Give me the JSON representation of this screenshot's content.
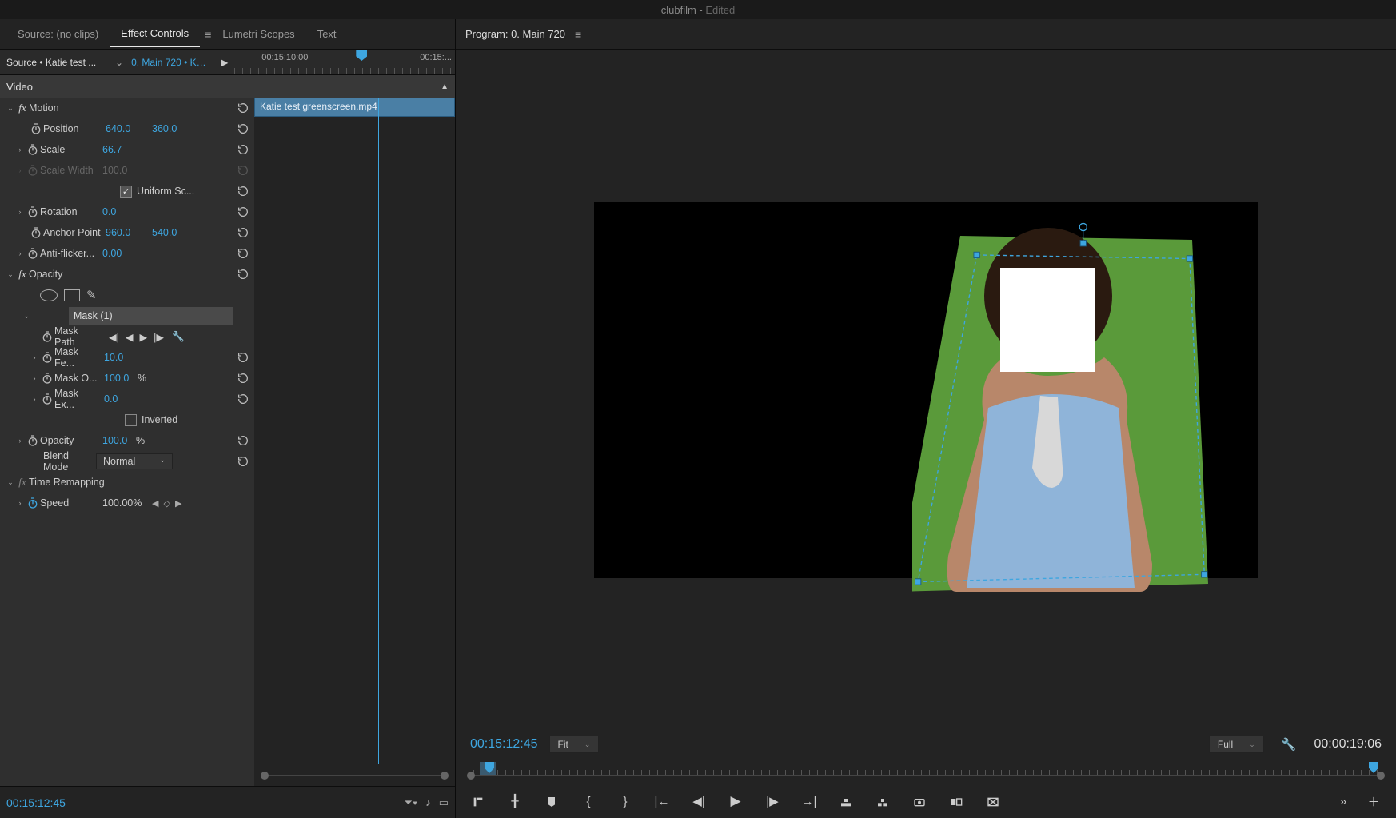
{
  "titlebar": {
    "project": "clubfilm",
    "status": "Edited"
  },
  "left": {
    "tabs": {
      "source": "Source: (no clips)",
      "effect_controls": "Effect Controls",
      "lumetri": "Lumetri Scopes",
      "text": "Text"
    },
    "src_header": {
      "source_clip": "Source • Katie test ...",
      "sequence": "0. Main 720 • Ka...",
      "ruler_tc1": "00:15:10:00",
      "ruler_tc2": "00:15:..."
    },
    "section_header": "Video",
    "clip_name": "Katie test greenscreen.mp4",
    "motion": {
      "label": "Motion",
      "position": {
        "label": "Position",
        "x": "640.0",
        "y": "360.0"
      },
      "scale": {
        "label": "Scale",
        "v": "66.7"
      },
      "scale_width": {
        "label": "Scale Width",
        "v": "100.0"
      },
      "uniform": {
        "label": "Uniform Sc...",
        "checked": true
      },
      "rotation": {
        "label": "Rotation",
        "v": "0.0"
      },
      "anchor": {
        "label": "Anchor Point",
        "x": "960.0",
        "y": "540.0"
      },
      "antiflicker": {
        "label": "Anti-flicker...",
        "v": "0.00"
      }
    },
    "opacity": {
      "label": "Opacity",
      "mask_name": "Mask (1)",
      "mask_path": "Mask Path",
      "mask_feather": {
        "label": "Mask Fe...",
        "v": "10.0"
      },
      "mask_opacity": {
        "label": "Mask O...",
        "v": "100.0",
        "unit": "%"
      },
      "mask_expansion": {
        "label": "Mask Ex...",
        "v": "0.0"
      },
      "inverted": {
        "label": "Inverted",
        "checked": false
      },
      "opacity_val": {
        "label": "Opacity",
        "v": "100.0",
        "unit": "%"
      },
      "blend": {
        "label": "Blend Mode",
        "v": "Normal"
      }
    },
    "time_remap": {
      "label": "Time Remapping",
      "speed": {
        "label": "Speed",
        "v": "100.00%"
      }
    },
    "footer_tc": "00:15:12:45"
  },
  "right": {
    "header": "Program: 0. Main 720",
    "footer": {
      "tc_left": "00:15:12:45",
      "zoom": "Fit",
      "res": "Full",
      "tc_right": "00:00:19:06"
    }
  }
}
